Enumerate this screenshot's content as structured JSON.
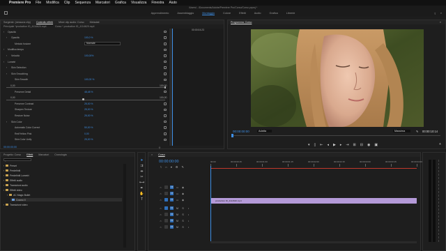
{
  "menubar": {
    "app": "Premiere Pro",
    "items": [
      "File",
      "Modifica",
      "Clip",
      "Sequenza",
      "Marcatori",
      "Grafica",
      "Visualizza",
      "Finestra",
      "Aiuto"
    ]
  },
  "path": "/Users/.../Documents/Adobe/Premiere Pro/Corso/Corso.prproj *",
  "workspaces": {
    "items": [
      "Apprendimento",
      "Assemblaggio",
      "Montaggio",
      "Colore",
      "Effetti",
      "Audio",
      "Grafica",
      "Librerie"
    ],
    "active_index": 2
  },
  "effect_panel": {
    "tabs": [
      "Sorgente: (nessuna clip)",
      "Controllo effetti",
      "Mixer clip audio: Corso",
      "Metadati"
    ],
    "active_tab": 1,
    "source": "Principale *production ID_4114620.mp4",
    "target": "Corso * production ID_4114620.mp4",
    "timecode_top": "00:00:04:23",
    "timecode_bottom": "00:00:00:00",
    "rows": [
      {
        "label": "Opacità",
        "value": "",
        "indent": 1
      },
      {
        "label": "Opacità",
        "value": "100,0 %",
        "indent": 2
      },
      {
        "label": "Metodo fusione",
        "value": "",
        "indent": 3,
        "select": "Normale"
      },
      {
        "label": "Modifica tempo",
        "value": "",
        "indent": 1
      },
      {
        "label": "Velocità",
        "value": "100,00%",
        "indent": 2
      },
      {
        "label": "Lumetri",
        "value": "",
        "indent": 1
      },
      {
        "label": "Skin Selection",
        "value": "",
        "indent": 2
      },
      {
        "label": "Skin Smoothing",
        "value": "",
        "indent": 2
      },
      {
        "label": "Skin Smooth",
        "value": "100,00 %",
        "indent": 3
      },
      {
        "label": "0,00",
        "value": "100,00",
        "indent": 3
      },
      {
        "label": "Preserve Detail",
        "value": "48,48 %",
        "indent": 3
      },
      {
        "label": "0,00",
        "value": "100,00",
        "indent": 3
      },
      {
        "label": "Preserve Contrast",
        "value": "25,00 %",
        "indent": 3
      },
      {
        "label": "Sharpen Texture",
        "value": "25,00 %",
        "indent": 3
      },
      {
        "label": "Restore Noise",
        "value": "25,00 %",
        "indent": 3
      },
      {
        "label": "Skin Color",
        "value": "",
        "indent": 2
      },
      {
        "label": "Automatic Color Correct",
        "value": "50,00 %",
        "indent": 3
      },
      {
        "label": "Red/Yellow Pink",
        "value": "0,00",
        "indent": 3
      },
      {
        "label": "Skin Color Unify",
        "value": "25,00 %",
        "indent": 3
      }
    ]
  },
  "program": {
    "title": "Programma: Corso",
    "timecode": "00:00:00:00",
    "fit": "Adatta",
    "quality": "Massima",
    "duration": "00:00:10:14",
    "controls": [
      "mark-in",
      "mark-out",
      "go-in",
      "step-back",
      "play",
      "step-forward",
      "go-out",
      "insert",
      "overwrite",
      "export-frame",
      "comparison",
      "add"
    ]
  },
  "project": {
    "tabs": [
      "Progetto: Corso",
      "Effetti",
      "Marcatori",
      "Cronologia"
    ],
    "active_tab": 1,
    "search_placeholder": "",
    "tree": [
      {
        "label": "Preset",
        "type": "folder",
        "indent": 1
      },
      {
        "label": "Predefiniti",
        "type": "folder",
        "indent": 1
      },
      {
        "label": "Predefiniti Lumetri",
        "type": "folder",
        "indent": 1
      },
      {
        "label": "Effetti audio",
        "type": "folder",
        "indent": 1
      },
      {
        "label": "Transizioni audio",
        "type": "folder",
        "indent": 1
      },
      {
        "label": "Effetti video",
        "type": "folder",
        "indent": 1
      },
      {
        "label": "AC Magic Bullet",
        "type": "folder",
        "indent": 2
      },
      {
        "label": "Cosmo II",
        "type": "effect",
        "indent": 3
      },
      {
        "label": "Transizioni video",
        "type": "folder",
        "indent": 1
      }
    ]
  },
  "timeline": {
    "title": "Corso",
    "timecode": "00:00:00:00",
    "ruler": [
      "00:00",
      "00:00:00:15",
      "00:00:01:00",
      "00:00:01:15",
      "00:00:02:00",
      "00:00:02:15",
      "00:00:03:00",
      "00:00:03:15",
      "00:00:04:00"
    ],
    "video_tracks": [
      "V3",
      "V2",
      "V1"
    ],
    "audio_tracks": [
      "A1",
      "A2",
      "A3",
      "A4"
    ],
    "clip_label": "production ID_4114620.mp4",
    "clip_color": "#b49ad8",
    "playhead_color": "#3d8fe6"
  },
  "colors": {
    "accent": "#3d8fe6",
    "panel": "#1e1e1e",
    "track_red": "#c0392b"
  }
}
